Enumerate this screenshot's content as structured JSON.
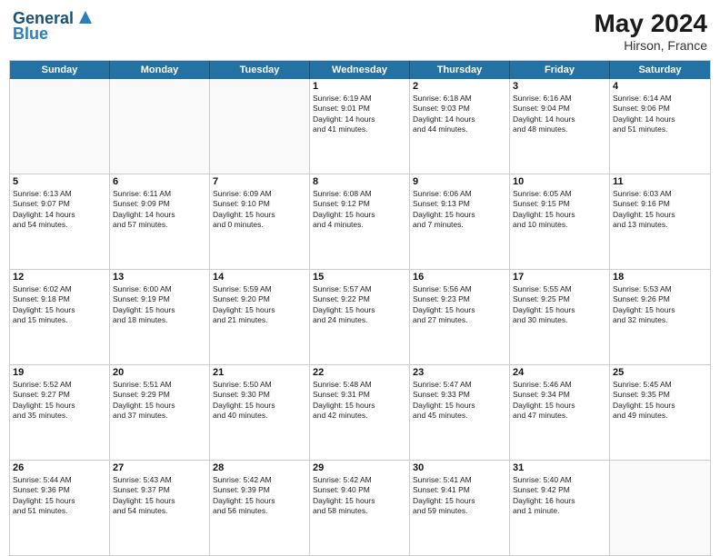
{
  "header": {
    "logo_line1": "General",
    "logo_line2": "Blue",
    "month_year": "May 2024",
    "location": "Hirson, France"
  },
  "days_of_week": [
    "Sunday",
    "Monday",
    "Tuesday",
    "Wednesday",
    "Thursday",
    "Friday",
    "Saturday"
  ],
  "weeks": [
    [
      {
        "day": "",
        "text": ""
      },
      {
        "day": "",
        "text": ""
      },
      {
        "day": "",
        "text": ""
      },
      {
        "day": "1",
        "text": "Sunrise: 6:19 AM\nSunset: 9:01 PM\nDaylight: 14 hours\nand 41 minutes."
      },
      {
        "day": "2",
        "text": "Sunrise: 6:18 AM\nSunset: 9:03 PM\nDaylight: 14 hours\nand 44 minutes."
      },
      {
        "day": "3",
        "text": "Sunrise: 6:16 AM\nSunset: 9:04 PM\nDaylight: 14 hours\nand 48 minutes."
      },
      {
        "day": "4",
        "text": "Sunrise: 6:14 AM\nSunset: 9:06 PM\nDaylight: 14 hours\nand 51 minutes."
      }
    ],
    [
      {
        "day": "5",
        "text": "Sunrise: 6:13 AM\nSunset: 9:07 PM\nDaylight: 14 hours\nand 54 minutes."
      },
      {
        "day": "6",
        "text": "Sunrise: 6:11 AM\nSunset: 9:09 PM\nDaylight: 14 hours\nand 57 minutes."
      },
      {
        "day": "7",
        "text": "Sunrise: 6:09 AM\nSunset: 9:10 PM\nDaylight: 15 hours\nand 0 minutes."
      },
      {
        "day": "8",
        "text": "Sunrise: 6:08 AM\nSunset: 9:12 PM\nDaylight: 15 hours\nand 4 minutes."
      },
      {
        "day": "9",
        "text": "Sunrise: 6:06 AM\nSunset: 9:13 PM\nDaylight: 15 hours\nand 7 minutes."
      },
      {
        "day": "10",
        "text": "Sunrise: 6:05 AM\nSunset: 9:15 PM\nDaylight: 15 hours\nand 10 minutes."
      },
      {
        "day": "11",
        "text": "Sunrise: 6:03 AM\nSunset: 9:16 PM\nDaylight: 15 hours\nand 13 minutes."
      }
    ],
    [
      {
        "day": "12",
        "text": "Sunrise: 6:02 AM\nSunset: 9:18 PM\nDaylight: 15 hours\nand 15 minutes."
      },
      {
        "day": "13",
        "text": "Sunrise: 6:00 AM\nSunset: 9:19 PM\nDaylight: 15 hours\nand 18 minutes."
      },
      {
        "day": "14",
        "text": "Sunrise: 5:59 AM\nSunset: 9:20 PM\nDaylight: 15 hours\nand 21 minutes."
      },
      {
        "day": "15",
        "text": "Sunrise: 5:57 AM\nSunset: 9:22 PM\nDaylight: 15 hours\nand 24 minutes."
      },
      {
        "day": "16",
        "text": "Sunrise: 5:56 AM\nSunset: 9:23 PM\nDaylight: 15 hours\nand 27 minutes."
      },
      {
        "day": "17",
        "text": "Sunrise: 5:55 AM\nSunset: 9:25 PM\nDaylight: 15 hours\nand 30 minutes."
      },
      {
        "day": "18",
        "text": "Sunrise: 5:53 AM\nSunset: 9:26 PM\nDaylight: 15 hours\nand 32 minutes."
      }
    ],
    [
      {
        "day": "19",
        "text": "Sunrise: 5:52 AM\nSunset: 9:27 PM\nDaylight: 15 hours\nand 35 minutes."
      },
      {
        "day": "20",
        "text": "Sunrise: 5:51 AM\nSunset: 9:29 PM\nDaylight: 15 hours\nand 37 minutes."
      },
      {
        "day": "21",
        "text": "Sunrise: 5:50 AM\nSunset: 9:30 PM\nDaylight: 15 hours\nand 40 minutes."
      },
      {
        "day": "22",
        "text": "Sunrise: 5:48 AM\nSunset: 9:31 PM\nDaylight: 15 hours\nand 42 minutes."
      },
      {
        "day": "23",
        "text": "Sunrise: 5:47 AM\nSunset: 9:33 PM\nDaylight: 15 hours\nand 45 minutes."
      },
      {
        "day": "24",
        "text": "Sunrise: 5:46 AM\nSunset: 9:34 PM\nDaylight: 15 hours\nand 47 minutes."
      },
      {
        "day": "25",
        "text": "Sunrise: 5:45 AM\nSunset: 9:35 PM\nDaylight: 15 hours\nand 49 minutes."
      }
    ],
    [
      {
        "day": "26",
        "text": "Sunrise: 5:44 AM\nSunset: 9:36 PM\nDaylight: 15 hours\nand 51 minutes."
      },
      {
        "day": "27",
        "text": "Sunrise: 5:43 AM\nSunset: 9:37 PM\nDaylight: 15 hours\nand 54 minutes."
      },
      {
        "day": "28",
        "text": "Sunrise: 5:42 AM\nSunset: 9:39 PM\nDaylight: 15 hours\nand 56 minutes."
      },
      {
        "day": "29",
        "text": "Sunrise: 5:42 AM\nSunset: 9:40 PM\nDaylight: 15 hours\nand 58 minutes."
      },
      {
        "day": "30",
        "text": "Sunrise: 5:41 AM\nSunset: 9:41 PM\nDaylight: 15 hours\nand 59 minutes."
      },
      {
        "day": "31",
        "text": "Sunrise: 5:40 AM\nSunset: 9:42 PM\nDaylight: 16 hours\nand 1 minute."
      },
      {
        "day": "",
        "text": ""
      }
    ]
  ]
}
